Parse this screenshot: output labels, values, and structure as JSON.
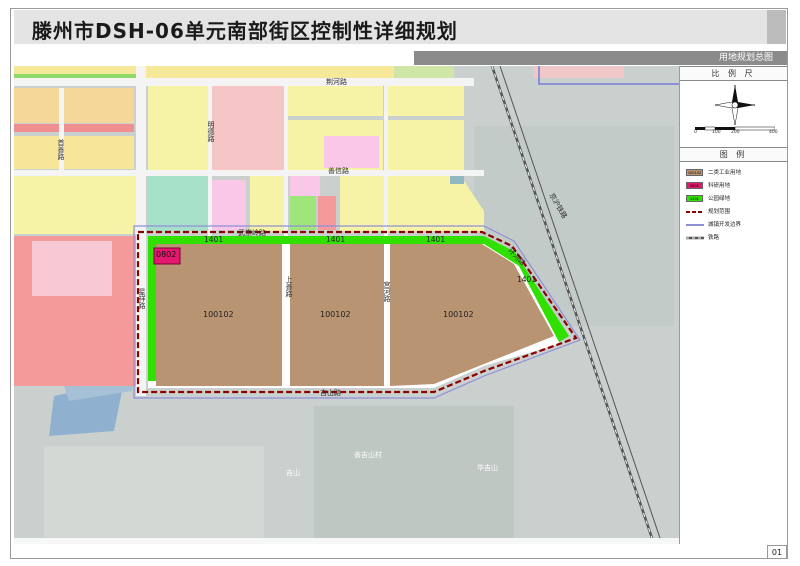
{
  "title": "滕州市DSH-06单元南部街区控制性详细规划",
  "subtitle": "用地规划总图",
  "page_number": "01",
  "scale_section": {
    "title": "比 例 尺",
    "scale_ticks": [
      "0",
      "100",
      "200",
      "400"
    ]
  },
  "legend": {
    "title": "图 例",
    "items": [
      {
        "code": "100102",
        "label": "二类工业用地",
        "color": "#b89472"
      },
      {
        "code": "0802",
        "label": "科研用地",
        "color": "#e5186f"
      },
      {
        "code": "1401",
        "label": "公园绿地",
        "color": "#2fe000"
      },
      {
        "code": "",
        "label": "规划范围",
        "color": "#8b0000"
      },
      {
        "code": "",
        "label": "城镇开发边界",
        "color": "#8f8fd8"
      },
      {
        "code": "",
        "label": "铁路",
        "color": "#555555"
      }
    ]
  },
  "map": {
    "roads": {
      "jinghe": "荆河路",
      "mingde": "明德路",
      "shouyi": "首善路",
      "shanxin": "善信路",
      "wuchongyi": "武崇岭路",
      "shangxian": "上善路",
      "gonghe": "宫河路",
      "xiangyun": "星祥路",
      "jishan": "吉山路",
      "jinghu": "京沪铁路",
      "huanhe": "环河路"
    },
    "plots": {
      "plot_a": "100102",
      "plot_b": "100102",
      "plot_c": "100102",
      "research": "0802"
    },
    "green_labels": {
      "g1": "1401",
      "g2": "1401",
      "g3": "1401",
      "g4": "1401"
    },
    "places": {
      "village_a": "善吉山村",
      "village_b": "华吉山",
      "place_jishan": "吉山"
    }
  }
}
